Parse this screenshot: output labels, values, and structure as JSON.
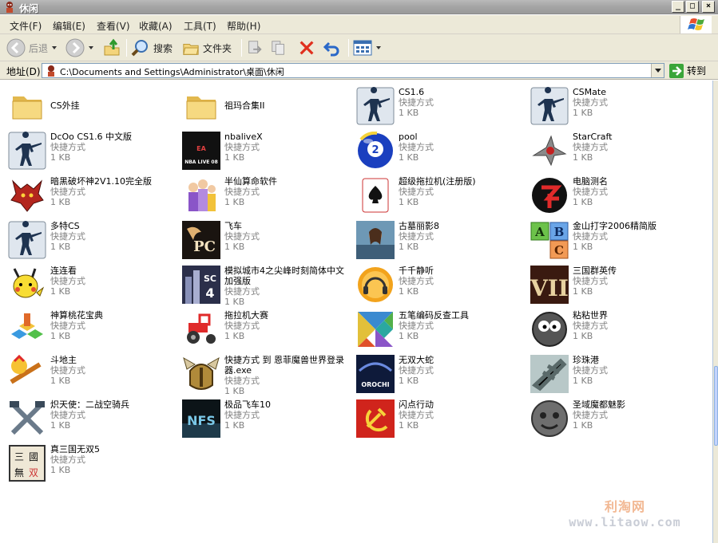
{
  "window": {
    "title": "休闲"
  },
  "window_buttons": {
    "minimize": "_",
    "maximize": "□",
    "close": "×"
  },
  "menu": [
    "文件(F)",
    "编辑(E)",
    "查看(V)",
    "收藏(A)",
    "工具(T)",
    "帮助(H)"
  ],
  "toolbar": {
    "back": "后退",
    "search": "搜索",
    "folders": "文件夹"
  },
  "address": {
    "label": "地址(D)",
    "path": "C:\\Documents and Settings\\Administrator\\桌面\\休闲",
    "go": "转到"
  },
  "items": [
    {
      "name": "CS外挂",
      "icon": "folder-icon"
    },
    {
      "name": "祖玛合集II",
      "icon": "folder-icon"
    },
    {
      "name": "CS1.6",
      "type": "快捷方式",
      "size": "1 KB",
      "icon": "cs-soldier-icon"
    },
    {
      "name": "CSMate",
      "type": "快捷方式",
      "size": "1 KB",
      "icon": "cs-soldier-icon"
    },
    {
      "name": "DcOo CS1.6 中文版",
      "type": "快捷方式",
      "size": "1 KB",
      "icon": "cs-soldier-icon"
    },
    {
      "name": "nbaliveX",
      "type": "快捷方式",
      "size": "1 KB",
      "icon": "nba-live-icon",
      "badge": "NBA LIVE 08"
    },
    {
      "name": "pool",
      "type": "快捷方式",
      "size": "1 KB",
      "icon": "billiard-ball-icon",
      "badge": "2"
    },
    {
      "name": "StarCraft",
      "type": "快捷方式",
      "size": "1 KB",
      "icon": "starcraft-icon"
    },
    {
      "name": "暗黑破坏神2V1.10完全版",
      "type": "快捷方式",
      "size": "1 KB",
      "icon": "diablo-icon"
    },
    {
      "name": "半仙算命软件",
      "type": "快捷方式",
      "size": "1 KB",
      "icon": "fortune-icon"
    },
    {
      "name": "超级拖拉机(注册版)",
      "type": "快捷方式",
      "size": "1 KB",
      "icon": "spade-card-icon"
    },
    {
      "name": "电脑测名",
      "type": "快捷方式",
      "size": "1 KB",
      "icon": "name-test-icon"
    },
    {
      "name": "多特CS",
      "type": "快捷方式",
      "size": "1 KB",
      "icon": "cs-soldier-icon"
    },
    {
      "name": "飞车",
      "type": "快捷方式",
      "size": "1 KB",
      "icon": "pc-racing-icon",
      "badge": "PC"
    },
    {
      "name": "古墓丽影8",
      "type": "快捷方式",
      "size": "1 KB",
      "icon": "tomb-raider-icon"
    },
    {
      "name": "金山打字2006精简版",
      "type": "快捷方式",
      "size": "1 KB",
      "icon": "abc-blocks-icon",
      "letters": [
        "A",
        "B",
        "C"
      ]
    },
    {
      "name": "连连看",
      "type": "快捷方式",
      "size": "1 KB",
      "icon": "pikachu-icon"
    },
    {
      "name": "模拟城市4之尖峰时刻简体中文加强版",
      "type": "快捷方式",
      "size": "1 KB",
      "icon": "simcity-icon",
      "badge": "SC4"
    },
    {
      "name": "千千静听",
      "type": "快捷方式",
      "size": "1 KB",
      "icon": "headphones-icon"
    },
    {
      "name": "三国群英传",
      "type": "快捷方式",
      "size": "1 KB",
      "icon": "roman-seven-icon",
      "badge": "VII"
    },
    {
      "name": "神算桃花宝典",
      "type": "快捷方式",
      "size": "1 KB",
      "icon": "blocks-icon"
    },
    {
      "name": "拖拉机大赛",
      "type": "快捷方式",
      "size": "1 KB",
      "icon": "tractor-icon"
    },
    {
      "name": "五笔编码反查工具",
      "type": "快捷方式",
      "size": "1 KB",
      "icon": "tangram-icon"
    },
    {
      "name": "粘粘世界",
      "type": "快捷方式",
      "size": "1 KB",
      "icon": "goo-ball-icon"
    },
    {
      "name": "斗地主",
      "type": "快捷方式",
      "size": "1 KB",
      "icon": "landlord-icon"
    },
    {
      "name": "快捷方式 到 恩菲魔兽世界登录器.exe",
      "type": "快捷方式",
      "size": "1 KB",
      "icon": "warcraft-helmet-icon"
    },
    {
      "name": "无双大蛇",
      "type": "快捷方式",
      "size": "1 KB",
      "icon": "orochi-icon",
      "badge": "OROCHI"
    },
    {
      "name": "珍珠港",
      "type": "快捷方式",
      "size": "1 KB",
      "icon": "airplane-icon"
    },
    {
      "name": "炽天使：二战空骑兵",
      "type": "快捷方式",
      "size": "1 KB",
      "icon": "crossed-tools-icon"
    },
    {
      "name": "极品飞车10",
      "type": "快捷方式",
      "size": "1 KB",
      "icon": "nfs-icon",
      "badge": "NFS"
    },
    {
      "name": "闪点行动",
      "type": "快捷方式",
      "size": "1 KB",
      "icon": "hammer-sickle-icon"
    },
    {
      "name": "圣域魔都魅影",
      "type": "快捷方式",
      "size": "1 KB",
      "icon": "demon-mask-icon"
    },
    {
      "name": "真三国无双5",
      "type": "快捷方式",
      "size": "1 KB",
      "icon": "dynasty-warriors-icon",
      "badge": "三國無双"
    }
  ],
  "watermark": {
    "cn": "利淘网",
    "en": "www.litaow.com"
  },
  "colors": {
    "folder": "#f3d47b",
    "accent": "#316ac5"
  }
}
